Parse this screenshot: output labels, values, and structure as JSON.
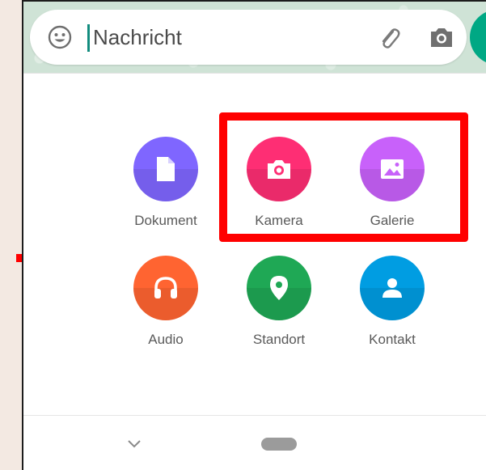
{
  "composer": {
    "placeholder": "Nachricht",
    "emoji_icon": "emoji-icon",
    "attach_icon": "paperclip-icon",
    "camera_icon": "camera-icon"
  },
  "attachments": [
    {
      "label": "Dokument",
      "icon": "document-icon",
      "color": "#7f66ff"
    },
    {
      "label": "Kamera",
      "icon": "camera-icon",
      "color": "#fe2e74"
    },
    {
      "label": "Galerie",
      "icon": "gallery-icon",
      "color": "#c861fa"
    },
    {
      "label": "Audio",
      "icon": "headphones-icon",
      "color": "#ff6431"
    },
    {
      "label": "Standort",
      "icon": "location-pin-icon",
      "color": "#1fa855"
    },
    {
      "label": "Kontakt",
      "icon": "contact-icon",
      "color": "#009de2"
    }
  ],
  "colors": {
    "highlight": "#ff0000",
    "accent": "#00a884"
  }
}
